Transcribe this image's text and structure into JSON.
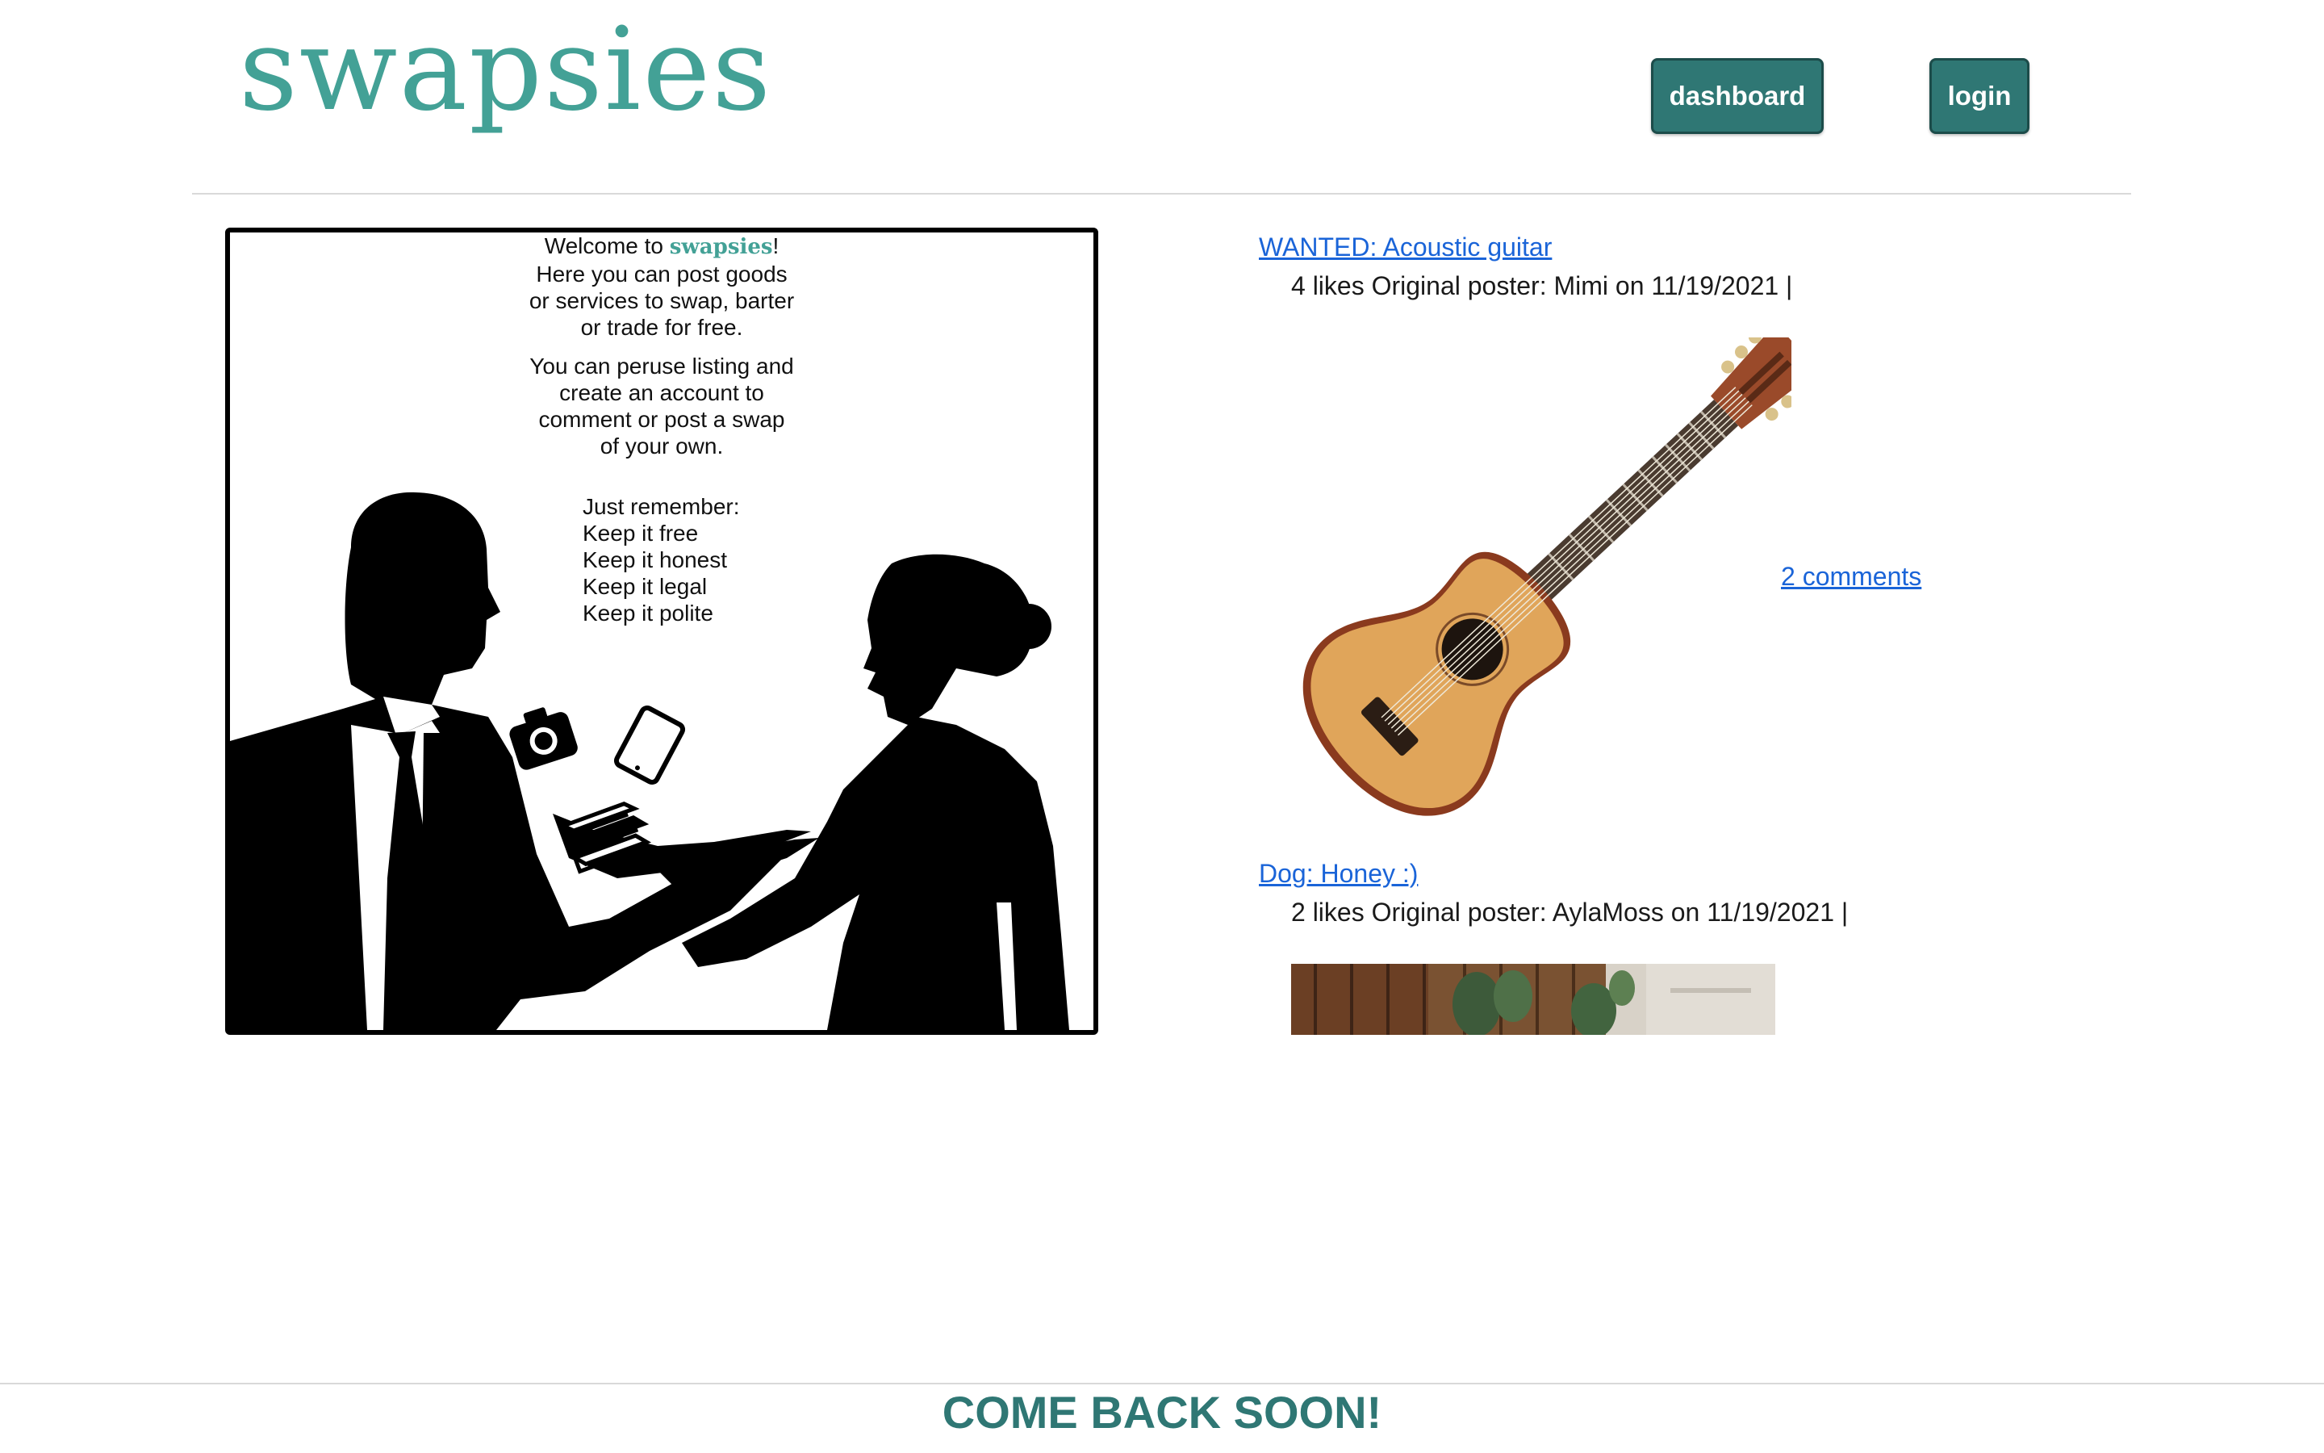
{
  "header": {
    "brand": "swapsies",
    "nav": {
      "dashboard_label": "dashboard",
      "login_label": "login"
    }
  },
  "welcome": {
    "greeting_prefix": "Welcome to ",
    "greeting_brand": "swapsies",
    "greeting_suffix": "!",
    "intro_lines": [
      "Here you can post goods",
      "or services to swap, barter",
      "or trade for free."
    ],
    "peruse_lines": [
      "You can peruse listing and",
      "create an account to",
      "comment or post a swap",
      "of your own."
    ],
    "rules_heading": "Just remember:",
    "rules": [
      "Keep it free",
      "Keep it honest",
      "Keep it legal",
      "Keep it polite"
    ]
  },
  "posts": [
    {
      "title": "WANTED: Acoustic guitar",
      "meta": "4 likes Original poster: Mimi on 11/19/2021 |",
      "comments_label": "2 comments",
      "image": "acoustic-guitar-photo"
    },
    {
      "title": "Dog: Honey :)",
      "meta": "2 likes Original poster: AylaMoss on 11/19/2021 |",
      "image": "dog-photo"
    }
  ],
  "footer": {
    "message": "COME BACK SOON!"
  },
  "colors": {
    "brand": "#43a196",
    "button": "#2f7774",
    "link": "#1a64d8"
  }
}
